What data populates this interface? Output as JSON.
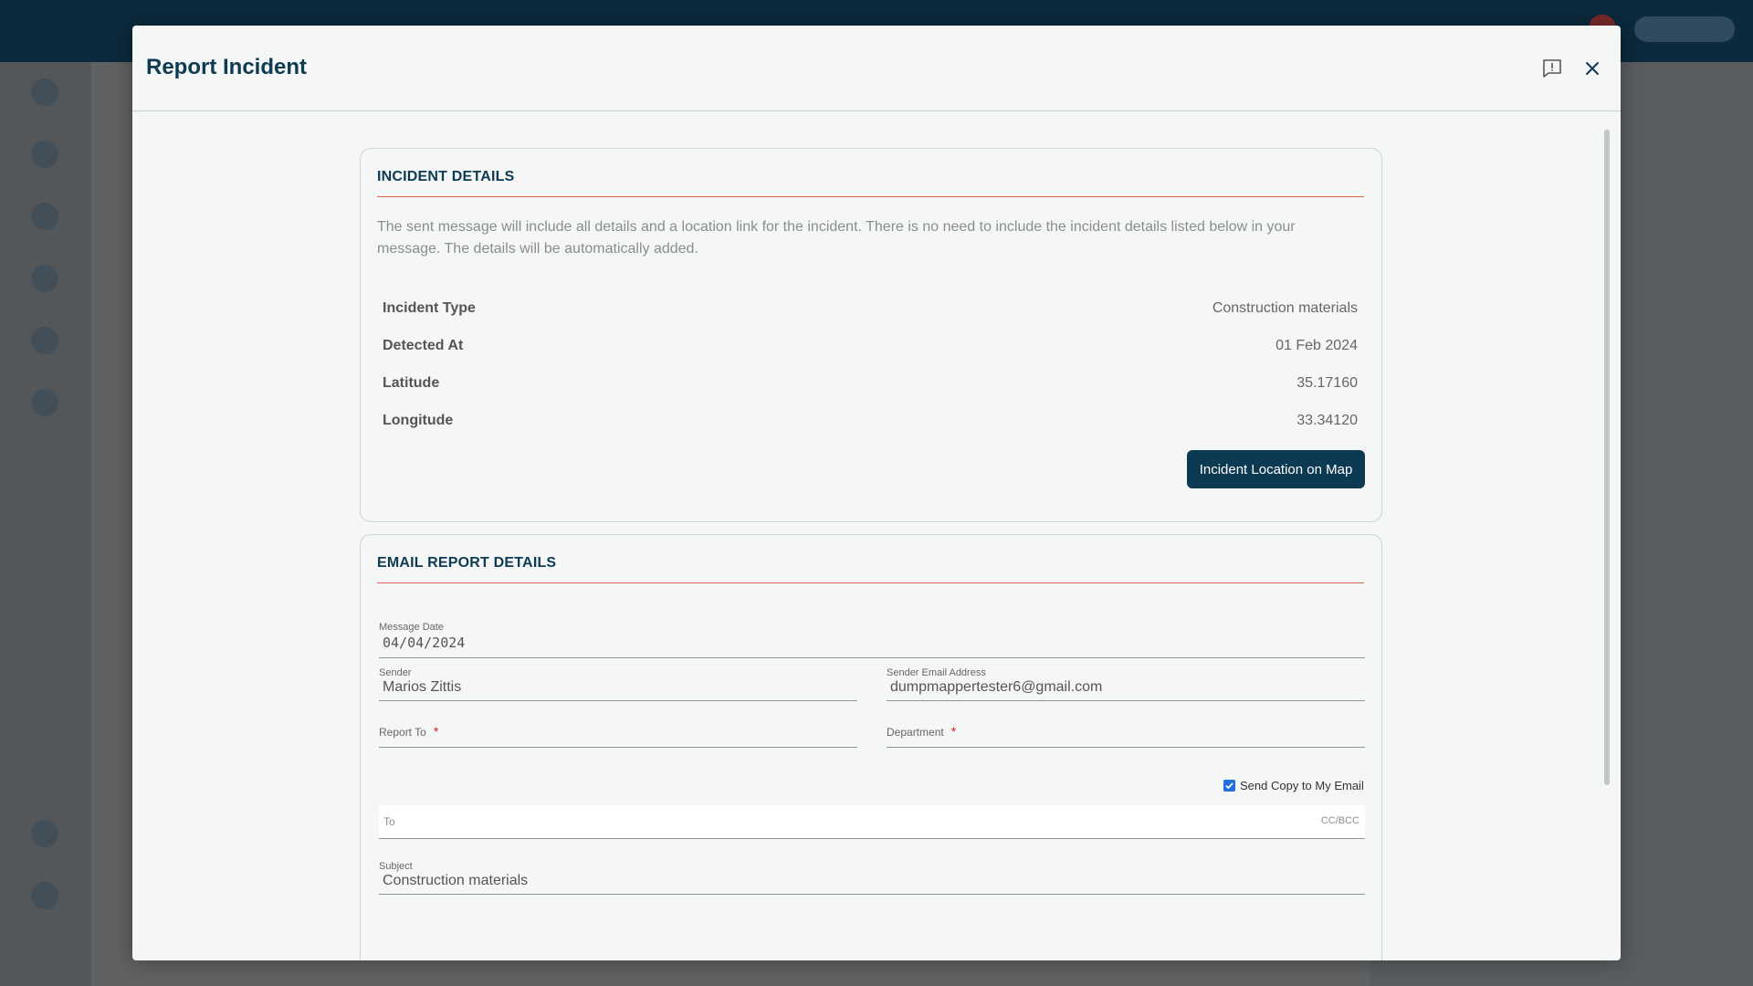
{
  "modal": {
    "title": "Report Incident",
    "feedback_icon": "feedback-icon",
    "close_icon": "close-icon"
  },
  "incident_details": {
    "heading": "INCIDENT DETAILS",
    "description": "The sent message will include all details and a location link for the incident. There is no need to include the incident details listed below in your message. The details will be automatically added.",
    "rows": [
      {
        "key": "Incident Type",
        "value": "Construction materials"
      },
      {
        "key": "Detected At",
        "value": "01 Feb 2024"
      },
      {
        "key": "Latitude",
        "value": "35.17160"
      },
      {
        "key": "Longitude",
        "value": "33.34120"
      }
    ],
    "map_button_label": "Incident Location on Map"
  },
  "email_report": {
    "heading": "EMAIL REPORT DETAILS",
    "message_date": {
      "label": "Message Date",
      "value": "04/04/2024"
    },
    "sender": {
      "label": "Sender",
      "value": "Marios Zittis"
    },
    "sender_email": {
      "label": "Sender Email Address",
      "value": "dumpmappertester6@gmail.com"
    },
    "report_to": {
      "label": "Report To",
      "required": "*",
      "value": ""
    },
    "department": {
      "label": "Department",
      "required": "*",
      "value": ""
    },
    "send_copy": {
      "label": "Send Copy to My Email",
      "checked": true
    },
    "to": {
      "label": "To",
      "ccbcc": "CC/BCC"
    },
    "subject": {
      "label": "Subject",
      "value": "Construction materials"
    }
  },
  "colors": {
    "brand": "#0c3a52",
    "accent_rule": "#d9664a",
    "required": "#d21f1f",
    "checkbox": "#1f6fe0"
  }
}
